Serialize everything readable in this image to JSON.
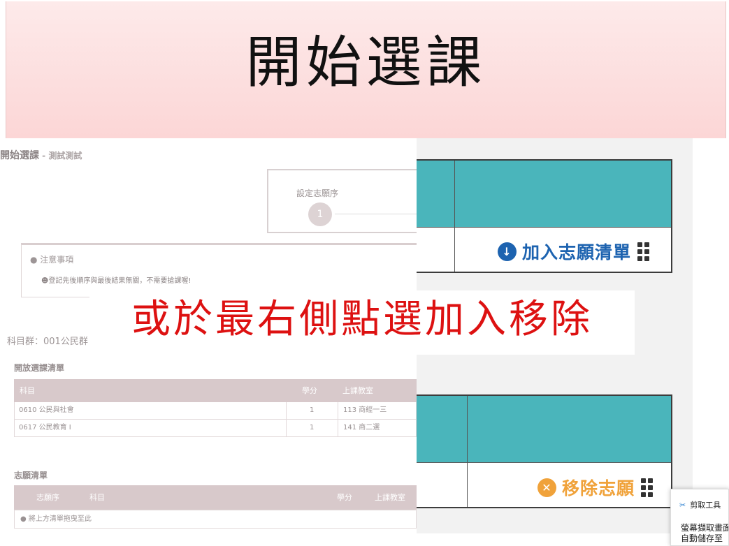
{
  "banner": {
    "title": "開始選課"
  },
  "breadcrumb": {
    "title": "開始選課",
    "subtitle": " - 測試測試"
  },
  "step": {
    "label": "設定志願序",
    "number": "1"
  },
  "notice": {
    "title": "注意事項",
    "item": "登記先後順序與最後結果無關，不需要搶課喔!"
  },
  "course_group": "科目群：001公民群",
  "open_list": {
    "title": "開放選課清單",
    "columns": [
      "科目",
      "學分",
      "上課教室"
    ],
    "rows": [
      {
        "subject": "0610 公民與社會",
        "credit": "1",
        "room": "113 商經一三"
      },
      {
        "subject": "0617 公民教育 I",
        "credit": "1",
        "room": "141 商二選"
      }
    ]
  },
  "wish_list": {
    "title": "志願清單",
    "columns": [
      "志願序",
      "科目",
      "學分",
      "上課教室"
    ],
    "empty": "將上方清單拖曳至此"
  },
  "actions": {
    "add": "加入志願清單",
    "remove": "移除志願"
  },
  "overlay": {
    "text": "或於最右側點選加入移除"
  },
  "snipping": {
    "app": "剪取工具",
    "msg": "螢幕擷取畫面已",
    "msg2": "自動儲存至"
  },
  "colors": {
    "teal_header": "#4ab5bb",
    "add_blue": "#1d63b0",
    "remove_orange": "#f0a23a",
    "banner_pink": "#fcd6d6",
    "overlay_red": "#dd1111"
  }
}
